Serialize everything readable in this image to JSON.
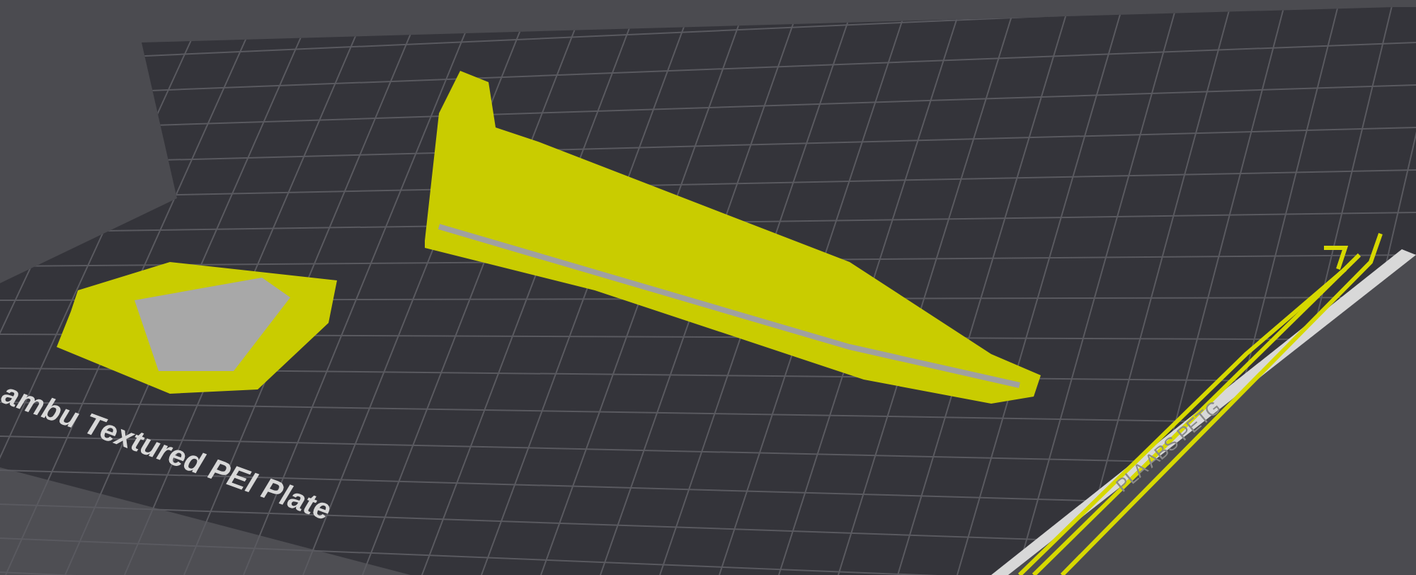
{
  "build_plate": {
    "plate_label": "ambu Textured PEI Plate",
    "filament_label": "PLA ABS PETG"
  }
}
